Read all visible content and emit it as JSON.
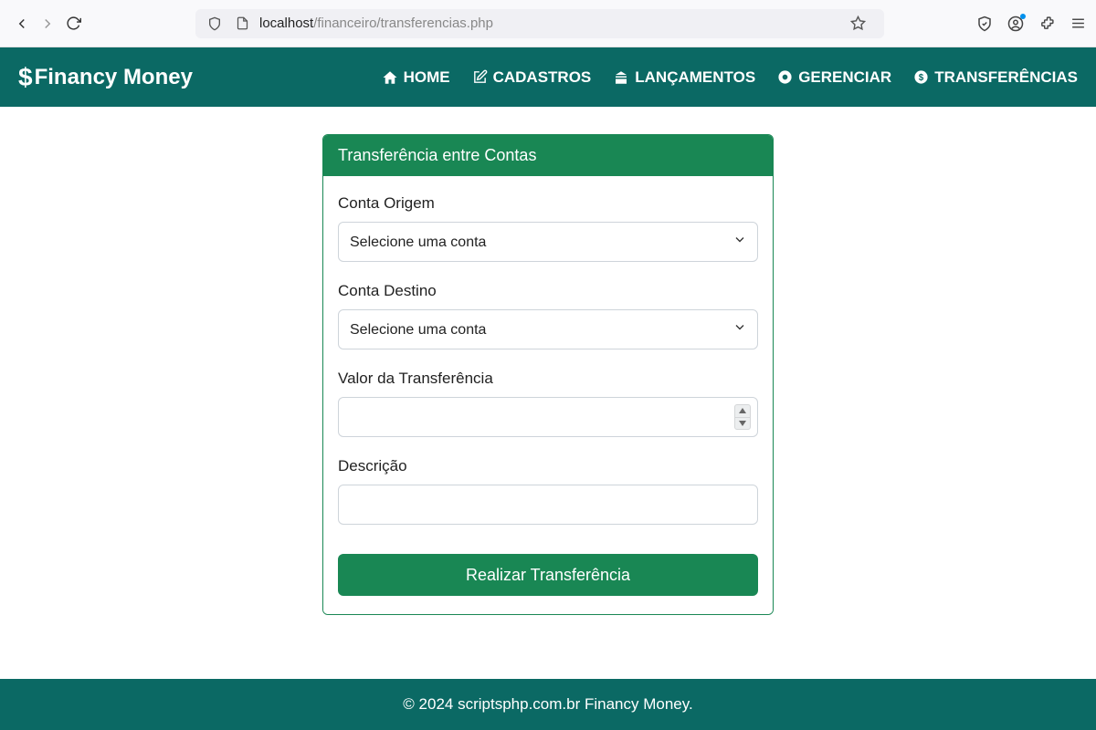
{
  "browser": {
    "url_host": "localhost",
    "url_path": "/financeiro/transferencias.php"
  },
  "navbar": {
    "brand": "Financy Money",
    "menu": [
      {
        "label": "HOME"
      },
      {
        "label": "CADASTROS"
      },
      {
        "label": "LANÇAMENTOS"
      },
      {
        "label": "GERENCIAR"
      },
      {
        "label": "TRANSFERÊNCIAS"
      }
    ]
  },
  "card": {
    "title": "Transferência entre Contas",
    "fields": {
      "origem": {
        "label": "Conta Origem",
        "placeholder": "Selecione uma conta"
      },
      "destino": {
        "label": "Conta Destino",
        "placeholder": "Selecione uma conta"
      },
      "valor": {
        "label": "Valor da Transferência"
      },
      "descricao": {
        "label": "Descrição"
      }
    },
    "submit": "Realizar Transferência"
  },
  "footer": "© 2024 scriptsphp.com.br Financy Money."
}
